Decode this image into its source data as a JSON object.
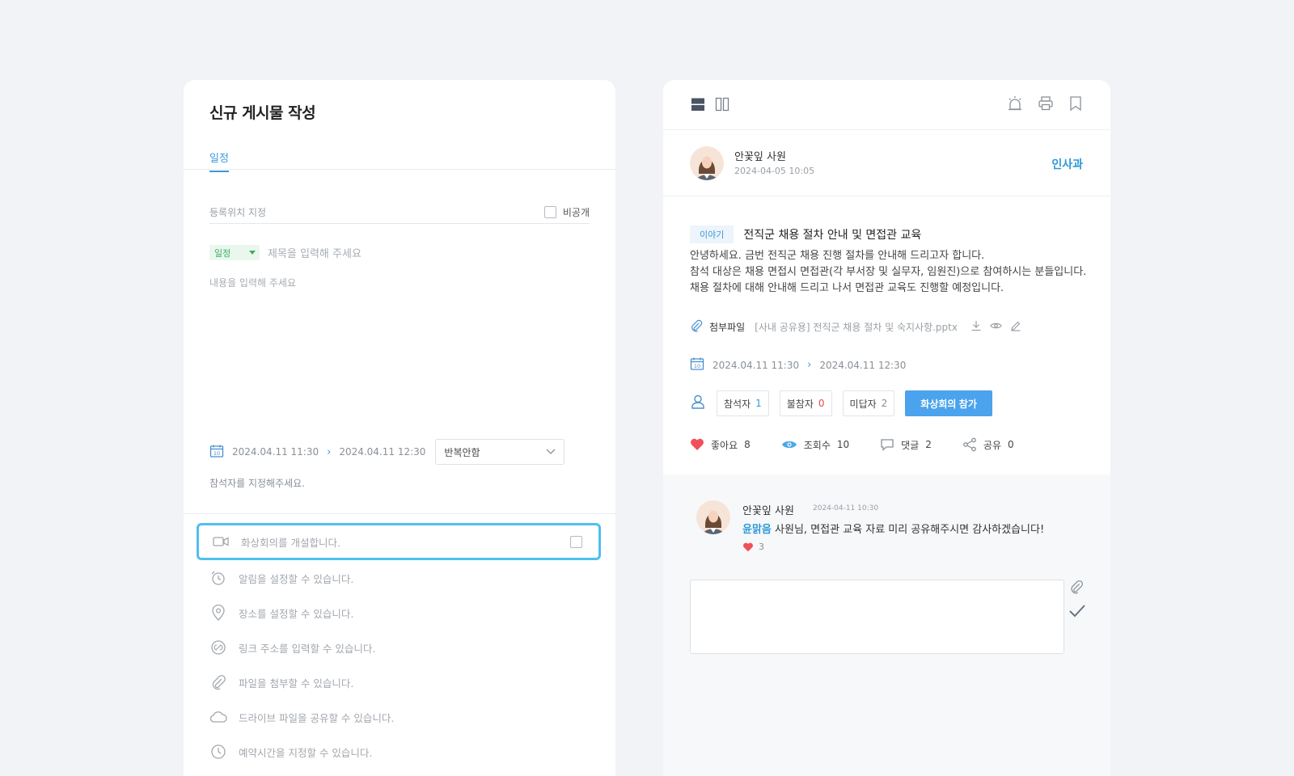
{
  "editor": {
    "title": "신규 게시물 작성",
    "tab": "일정",
    "location_placeholder": "등록위치 지정",
    "private_label": "비공개",
    "category": "일정",
    "title_placeholder": "제목을 입력해 주세요",
    "content_placeholder": "내용을 입력해 주세요",
    "start": "2024.04.11 11:30",
    "end": "2024.04.11 12:30",
    "repeat": "반복안함",
    "attendee_note": "참석자를 지정해주세요.",
    "options": {
      "video": "화상회의를 개설합니다.",
      "alarm": "알림을 설정할 수 있습니다.",
      "place": "장소를 설정할 수 있습니다.",
      "link": "링크 주소를 입력할 수 있습니다.",
      "file": "파일을 첨부할 수 있습니다.",
      "drive": "드라이브 파일을 공유할 수 있습니다.",
      "reserve": "예약시간을 지정할 수 있습니다."
    }
  },
  "post": {
    "author": "안꽃잎 사원",
    "date": "2024-04-05 10:05",
    "department": "인사과",
    "tag": "이야기",
    "title": "전직군 채용 절차 안내 및 면접관 교육",
    "body": [
      "안녕하세요. 금번 전직군 채용 진행 절차를 안내해 드리고자 합니다.",
      "참석 대상은 채용 면접시 면접관(각 부서장 및 실무자, 임원진)으로 참여하시는 분들입니다.",
      "채용 절차에 대해 안내해 드리고 나서 면접관 교육도 진행할 예정입니다."
    ],
    "attach_label": "첨부파일",
    "attach_file": "[사내 공유용] 전직군 채용 절차 및 숙지사항.pptx",
    "start": "2024.04.11 11:30",
    "end": "2024.04.11 12:30",
    "attendance": {
      "attend_label": "참석자",
      "attend_count": "1",
      "absent_label": "불참자",
      "absent_count": "0",
      "pending_label": "미답자",
      "pending_count": "2"
    },
    "join_button": "화상회의 참가",
    "stats": {
      "like_label": "좋아요",
      "like_count": "8",
      "view_label": "조회수",
      "view_count": "10",
      "comment_label": "댓글",
      "comment_count": "2",
      "share_label": "공유",
      "share_count": "0"
    }
  },
  "comment": {
    "author": "안꽃잎 사원",
    "date": "2024-04-11 10:30",
    "mention": "윤맑음",
    "text": " 사원님, 면접관 교육 자료 미리 공유해주시면 감사하겠습니다!",
    "likes": "3"
  },
  "colors": {
    "accent": "#3a9ad9",
    "highlight_border": "#4fc0ee",
    "join_button": "#4aa3ec",
    "like_heart": "#f0505a",
    "category_green": "#3fae5e"
  }
}
